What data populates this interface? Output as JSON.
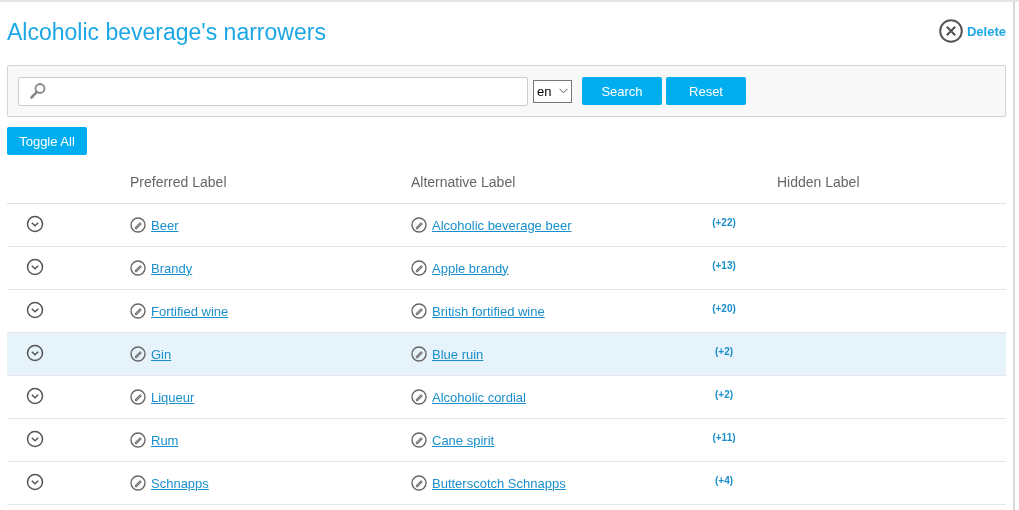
{
  "title": "Alcoholic beverage's narrowers",
  "delete_action": {
    "label": "Delete"
  },
  "search": {
    "language": "en",
    "buttons": [
      "Search",
      "Reset"
    ]
  },
  "toggle_all": {
    "label": "Toggle All"
  },
  "table": {
    "columns": [
      "Preferred Label",
      "Alternative Label",
      "Hidden Label"
    ],
    "rows": [
      {
        "preferred": "Beer",
        "alternative": "Alcoholic beverage beer",
        "more": "(+22)",
        "selected": false
      },
      {
        "preferred": "Brandy",
        "alternative": "Apple brandy",
        "more": "(+13)",
        "selected": false
      },
      {
        "preferred": "Fortified wine",
        "alternative": "British fortified wine",
        "more": "(+20)",
        "selected": false
      },
      {
        "preferred": "Gin",
        "alternative": "Blue ruin",
        "more": "(+2)",
        "selected": true
      },
      {
        "preferred": "Liqueur",
        "alternative": "Alcoholic cordial",
        "more": "(+2)",
        "selected": false
      },
      {
        "preferred": "Rum",
        "alternative": "Cane spirit",
        "more": "(+11)",
        "selected": false
      },
      {
        "preferred": "Schnapps",
        "alternative": "Butterscotch Schnapps",
        "more": "(+4)",
        "selected": false
      }
    ]
  }
}
